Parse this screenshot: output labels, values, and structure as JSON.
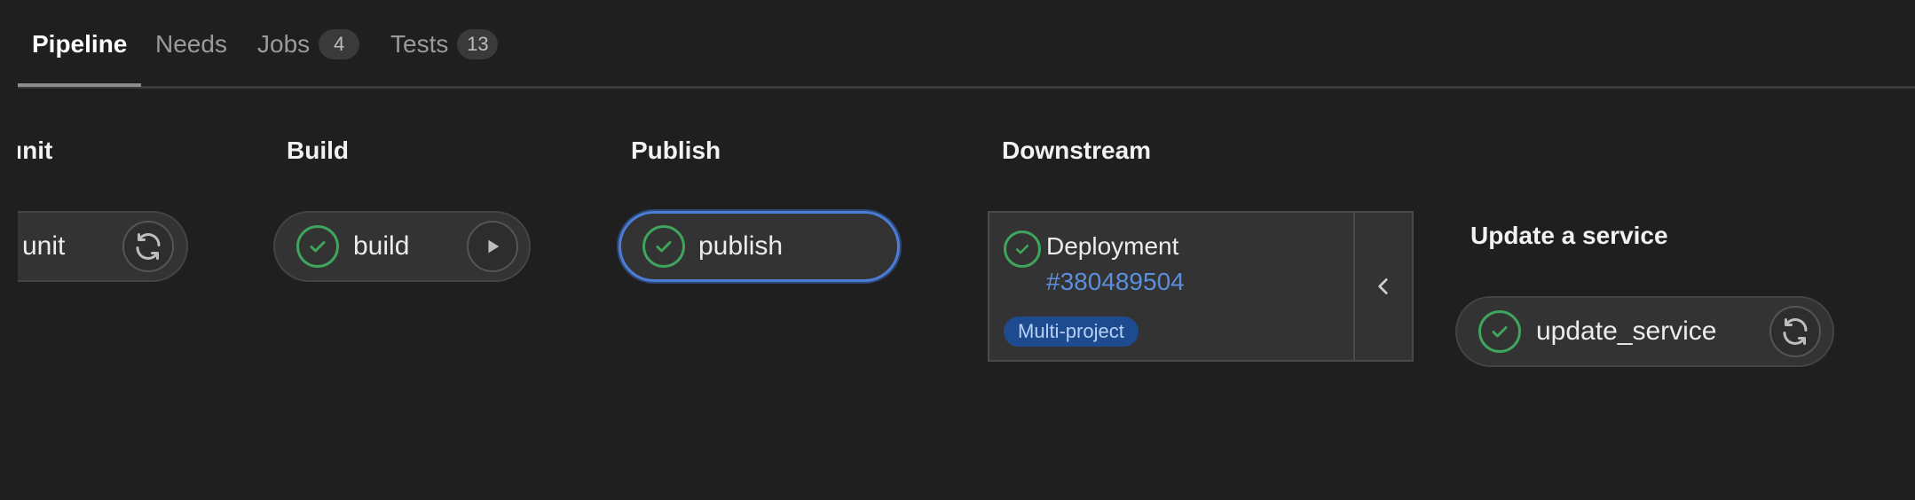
{
  "tabs": [
    {
      "label": "Pipeline",
      "active": true
    },
    {
      "label": "Needs"
    },
    {
      "label": "Jobs",
      "count": "4"
    },
    {
      "label": "Tests",
      "count": "13"
    }
  ],
  "stages": {
    "unit": {
      "title": "unit",
      "job": {
        "name": "unit",
        "action_icon": "retry-icon"
      }
    },
    "build": {
      "title": "Build",
      "job": {
        "name": "build",
        "status_icon": "check-circle-icon",
        "action_icon": "play-icon"
      }
    },
    "publish": {
      "title": "Publish",
      "job": {
        "name": "publish",
        "status_icon": "check-circle-icon"
      }
    },
    "downstream": {
      "title": "Downstream",
      "card": {
        "name": "Deployment",
        "pipeline_id": "#380489504",
        "badge": "Multi-project",
        "toggle_icon": "chevron-left-icon"
      }
    },
    "update": {
      "title": "Update a service",
      "job": {
        "name": "update_service",
        "status_icon": "check-circle-icon",
        "action_icon": "retry-icon"
      }
    }
  },
  "colors": {
    "background": "#1f1f1f",
    "success": "#3fa55c",
    "link": "#5b8fdd",
    "badge_bg": "#1e4b8f",
    "focus_ring": "#4c7ed6"
  }
}
